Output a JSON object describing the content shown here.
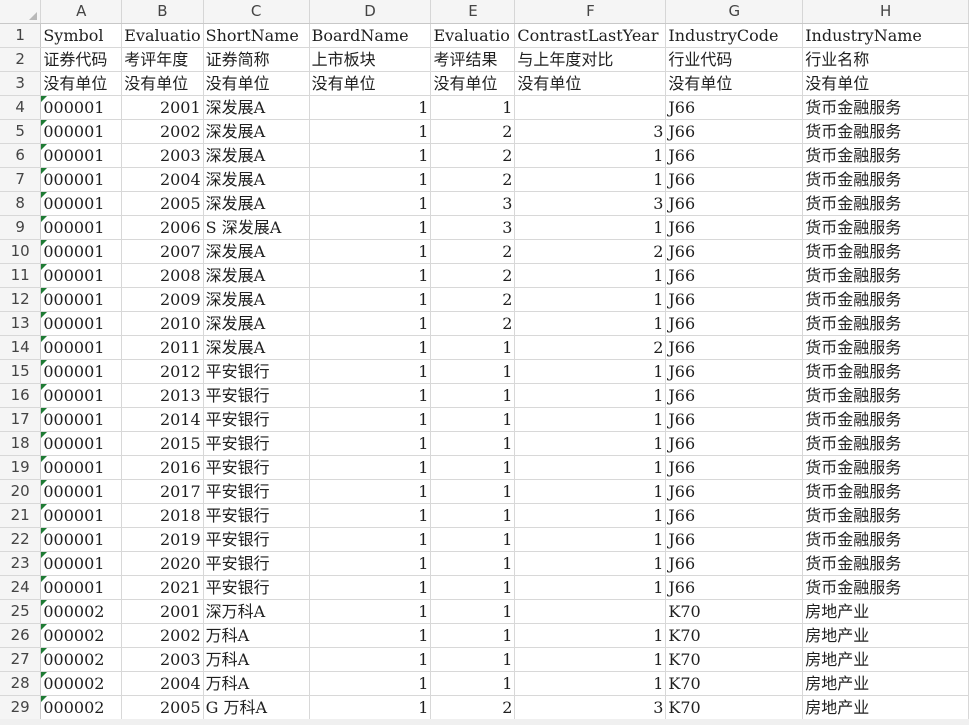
{
  "spreadsheet": {
    "columns": [
      "A",
      "B",
      "C",
      "D",
      "E",
      "F",
      "G",
      "H"
    ],
    "header_rows": [
      {
        "row": "1",
        "cells": [
          "Symbol",
          "Evaluatio",
          "ShortName",
          "BoardName",
          "Evaluatio",
          "ContrastLastYear",
          "IndustryCode",
          "IndustryName"
        ]
      },
      {
        "row": "2",
        "cells": [
          "证券代码",
          "考评年度",
          "证券简称",
          "上市板块",
          "考评结果",
          "与上年度对比",
          "行业代码",
          "行业名称"
        ]
      },
      {
        "row": "3",
        "cells": [
          "没有单位",
          "没有单位",
          "没有单位",
          "没有单位",
          "没有单位",
          "没有单位",
          "没有单位",
          "没有单位"
        ]
      }
    ],
    "data_rows": [
      {
        "row": "4",
        "cells": [
          "000001",
          "2001",
          "深发展A",
          "1",
          "1",
          "",
          "J66",
          "货币金融服务"
        ]
      },
      {
        "row": "5",
        "cells": [
          "000001",
          "2002",
          "深发展A",
          "1",
          "2",
          "3",
          "J66",
          "货币金融服务"
        ]
      },
      {
        "row": "6",
        "cells": [
          "000001",
          "2003",
          "深发展A",
          "1",
          "2",
          "1",
          "J66",
          "货币金融服务"
        ]
      },
      {
        "row": "7",
        "cells": [
          "000001",
          "2004",
          "深发展A",
          "1",
          "2",
          "1",
          "J66",
          "货币金融服务"
        ]
      },
      {
        "row": "8",
        "cells": [
          "000001",
          "2005",
          "深发展A",
          "1",
          "3",
          "3",
          "J66",
          "货币金融服务"
        ]
      },
      {
        "row": "9",
        "cells": [
          "000001",
          "2006",
          "S 深发展A",
          "1",
          "3",
          "1",
          "J66",
          "货币金融服务"
        ]
      },
      {
        "row": "10",
        "cells": [
          "000001",
          "2007",
          "深发展A",
          "1",
          "2",
          "2",
          "J66",
          "货币金融服务"
        ]
      },
      {
        "row": "11",
        "cells": [
          "000001",
          "2008",
          "深发展A",
          "1",
          "2",
          "1",
          "J66",
          "货币金融服务"
        ]
      },
      {
        "row": "12",
        "cells": [
          "000001",
          "2009",
          "深发展A",
          "1",
          "2",
          "1",
          "J66",
          "货币金融服务"
        ]
      },
      {
        "row": "13",
        "cells": [
          "000001",
          "2010",
          "深发展A",
          "1",
          "2",
          "1",
          "J66",
          "货币金融服务"
        ]
      },
      {
        "row": "14",
        "cells": [
          "000001",
          "2011",
          "深发展A",
          "1",
          "1",
          "2",
          "J66",
          "货币金融服务"
        ]
      },
      {
        "row": "15",
        "cells": [
          "000001",
          "2012",
          "平安银行",
          "1",
          "1",
          "1",
          "J66",
          "货币金融服务"
        ]
      },
      {
        "row": "16",
        "cells": [
          "000001",
          "2013",
          "平安银行",
          "1",
          "1",
          "1",
          "J66",
          "货币金融服务"
        ]
      },
      {
        "row": "17",
        "cells": [
          "000001",
          "2014",
          "平安银行",
          "1",
          "1",
          "1",
          "J66",
          "货币金融服务"
        ]
      },
      {
        "row": "18",
        "cells": [
          "000001",
          "2015",
          "平安银行",
          "1",
          "1",
          "1",
          "J66",
          "货币金融服务"
        ]
      },
      {
        "row": "19",
        "cells": [
          "000001",
          "2016",
          "平安银行",
          "1",
          "1",
          "1",
          "J66",
          "货币金融服务"
        ]
      },
      {
        "row": "20",
        "cells": [
          "000001",
          "2017",
          "平安银行",
          "1",
          "1",
          "1",
          "J66",
          "货币金融服务"
        ]
      },
      {
        "row": "21",
        "cells": [
          "000001",
          "2018",
          "平安银行",
          "1",
          "1",
          "1",
          "J66",
          "货币金融服务"
        ]
      },
      {
        "row": "22",
        "cells": [
          "000001",
          "2019",
          "平安银行",
          "1",
          "1",
          "1",
          "J66",
          "货币金融服务"
        ]
      },
      {
        "row": "23",
        "cells": [
          "000001",
          "2020",
          "平安银行",
          "1",
          "1",
          "1",
          "J66",
          "货币金融服务"
        ]
      },
      {
        "row": "24",
        "cells": [
          "000001",
          "2021",
          "平安银行",
          "1",
          "1",
          "1",
          "J66",
          "货币金融服务"
        ]
      },
      {
        "row": "25",
        "cells": [
          "000002",
          "2001",
          "深万科A",
          "1",
          "1",
          "",
          "K70",
          "房地产业"
        ]
      },
      {
        "row": "26",
        "cells": [
          "000002",
          "2002",
          "万科A",
          "1",
          "1",
          "1",
          "K70",
          "房地产业"
        ]
      },
      {
        "row": "27",
        "cells": [
          "000002",
          "2003",
          "万科A",
          "1",
          "1",
          "1",
          "K70",
          "房地产业"
        ]
      },
      {
        "row": "28",
        "cells": [
          "000002",
          "2004",
          "万科A",
          "1",
          "1",
          "1",
          "K70",
          "房地产业"
        ]
      },
      {
        "row": "29",
        "cells": [
          "000002",
          "2005",
          "G 万科A",
          "1",
          "2",
          "3",
          "K70",
          "房地产业"
        ]
      }
    ]
  }
}
